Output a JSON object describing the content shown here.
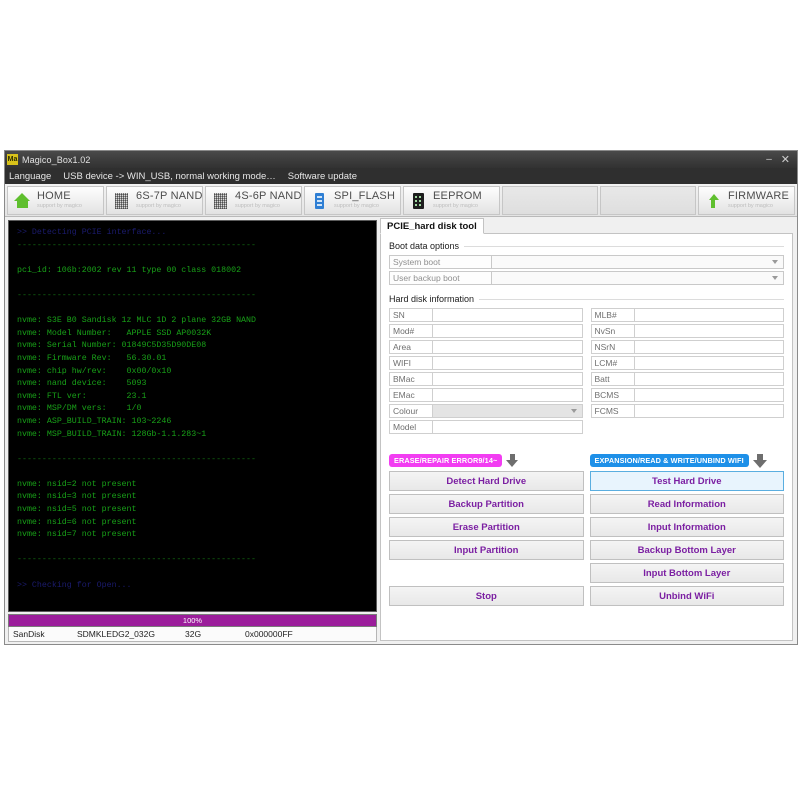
{
  "window": {
    "title": "Magico_Box1.02",
    "icon_label": "Ma",
    "minimize": "–",
    "close": "✕"
  },
  "menubar": {
    "items": [
      {
        "label": "Language"
      },
      {
        "label": "USB device -> WIN_USB, normal working mode…"
      },
      {
        "label": "Software update"
      }
    ]
  },
  "toolbar": {
    "subtitle": "support by magico",
    "tabs": [
      {
        "label": "HOME",
        "icon": "home-icon"
      },
      {
        "label": "6S-7P NAND",
        "icon": "chip-icon"
      },
      {
        "label": "4S-6P NAND",
        "icon": "chip-icon"
      },
      {
        "label": "SPI_FLASH",
        "icon": "spi-chip-icon"
      },
      {
        "label": "EEPROM",
        "icon": "eeprom-chip-icon"
      },
      {
        "label": "",
        "icon": ""
      },
      {
        "label": "",
        "icon": ""
      },
      {
        "label": "FIRMWARE",
        "icon": "firmware-upload-icon"
      }
    ]
  },
  "terminal": {
    "lines": [
      {
        "text": ">> Detecting PCIE interface...",
        "color": "blue"
      },
      {
        "text": "------------------------------------------------",
        "color": "sep"
      },
      {
        "text": "",
        "color": "blank"
      },
      {
        "text": "pci_id: 106b:2002 rev 11 type 00 class 018002",
        "color": "green"
      },
      {
        "text": "",
        "color": "blank"
      },
      {
        "text": "------------------------------------------------",
        "color": "sep"
      },
      {
        "text": "",
        "color": "blank"
      },
      {
        "text": "nvme: S3E B0 Sandisk 1z MLC 1D 2 plane 32GB NAND",
        "color": "green"
      },
      {
        "text": "nvme: Model Number:   APPLE SSD AP0032K",
        "color": "green"
      },
      {
        "text": "nvme: Serial Number: 01849C5D35D90DE08",
        "color": "green"
      },
      {
        "text": "nvme: Firmware Rev:   56.30.01",
        "color": "green"
      },
      {
        "text": "nvme: chip hw/rev:    0x00/0x10",
        "color": "green"
      },
      {
        "text": "nvme: nand device:    5093",
        "color": "green"
      },
      {
        "text": "nvme: FTL ver:        23.1",
        "color": "green"
      },
      {
        "text": "nvme: MSP/DM vers:    1/0",
        "color": "green"
      },
      {
        "text": "nvme: ASP_BUILD_TRAIN: 103~2246",
        "color": "green"
      },
      {
        "text": "nvme: MSP_BUILD_TRAIN: 128Gb-1.1.283~1",
        "color": "green"
      },
      {
        "text": "",
        "color": "blank"
      },
      {
        "text": "------------------------------------------------",
        "color": "sep"
      },
      {
        "text": "",
        "color": "blank"
      },
      {
        "text": "nvme: nsid=2 not present",
        "color": "green"
      },
      {
        "text": "nvme: nsid=3 not present",
        "color": "green"
      },
      {
        "text": "nvme: nsid=5 not present",
        "color": "green"
      },
      {
        "text": "nvme: nsid=6 not present",
        "color": "green"
      },
      {
        "text": "nvme: nsid=7 not present",
        "color": "green"
      },
      {
        "text": "",
        "color": "blank"
      },
      {
        "text": "------------------------------------------------",
        "color": "sep"
      },
      {
        "text": "",
        "color": "blank"
      },
      {
        "text": ">> Checking for Open...",
        "color": "blue"
      }
    ]
  },
  "progress": {
    "percent_label": "100%",
    "percent_value": 100,
    "fill_color": "#9b1d9b"
  },
  "device_bar": {
    "vendor": "SanDisk",
    "model": "SDMKLEDG2_032G",
    "capacity": "32G",
    "id": "0x000000FF"
  },
  "panel": {
    "tab_label": "PCIE_hard disk tool",
    "boot_section": {
      "title": "Boot data options",
      "rows": [
        {
          "label": "System boot",
          "value": ""
        },
        {
          "label": "User backup boot",
          "value": ""
        }
      ]
    },
    "hdi_section": {
      "title": "Hard disk information",
      "left_fields": [
        {
          "label": "SN",
          "value": "",
          "type": "text"
        },
        {
          "label": "Mod#",
          "value": "",
          "type": "text"
        },
        {
          "label": "Area",
          "value": "",
          "type": "text"
        },
        {
          "label": "WIFI",
          "value": "",
          "type": "text"
        },
        {
          "label": "BMac",
          "value": "",
          "type": "text"
        },
        {
          "label": "EMac",
          "value": "",
          "type": "text"
        },
        {
          "label": "Colour",
          "value": "",
          "type": "combo"
        },
        {
          "label": "Model",
          "value": "",
          "type": "text"
        }
      ],
      "right_fields": [
        {
          "label": "MLB#",
          "value": "",
          "type": "text"
        },
        {
          "label": "NvSn",
          "value": "",
          "type": "text"
        },
        {
          "label": "NSrN",
          "value": "",
          "type": "text"
        },
        {
          "label": "LCM#",
          "value": "",
          "type": "text"
        },
        {
          "label": "Batt",
          "value": "",
          "type": "text"
        },
        {
          "label": "BCMS",
          "value": "",
          "type": "text"
        },
        {
          "label": "FCMS",
          "value": "",
          "type": "text"
        }
      ]
    },
    "left_actions": {
      "banner": "ERASE/REPAIR ERROR9/14~",
      "banner_color": "#f23df2",
      "buttons": [
        {
          "label": "Detect Hard Drive"
        },
        {
          "label": "Backup Partition"
        },
        {
          "label": "Erase Partition"
        },
        {
          "label": "Input Partition"
        }
      ],
      "bottom_button": {
        "label": "Stop"
      }
    },
    "right_actions": {
      "banner": "EXPANSION/READ & WRITE/UNBIND WIFI",
      "banner_color": "#1e90e8",
      "buttons": [
        {
          "label": "Test Hard Drive",
          "highlight": true
        },
        {
          "label": "Read Information"
        },
        {
          "label": "Input Information"
        },
        {
          "label": "Backup Bottom Layer"
        },
        {
          "label": "Input Bottom Layer"
        }
      ],
      "bottom_button": {
        "label": "Unbind WiFi"
      }
    }
  }
}
